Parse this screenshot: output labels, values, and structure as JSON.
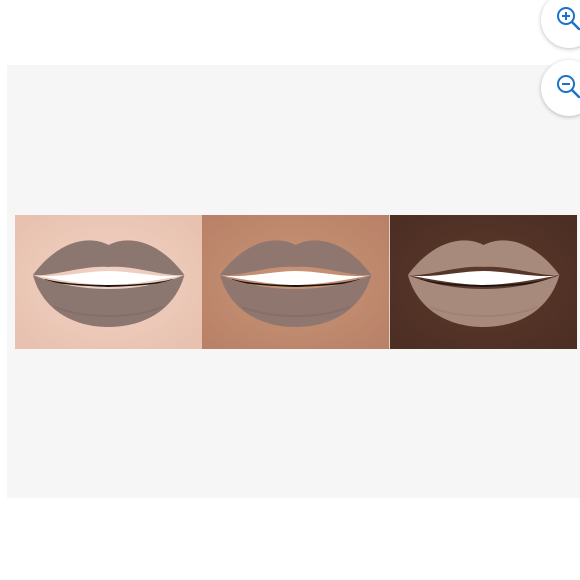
{
  "viewer": {
    "panels": [
      {
        "skin": "#f1d2c4",
        "skin_edge": "#e7c0ae",
        "lip": "#8c7670",
        "lip_dark": "#76615b"
      },
      {
        "skin": "#c99478",
        "skin_edge": "#b88167",
        "lip": "#8f7770",
        "lip_dark": "#77625b"
      },
      {
        "skin": "#5d3a2c",
        "skin_edge": "#4b2d22",
        "lip": "#a88a7c",
        "lip_dark": "#8e7366"
      }
    ]
  },
  "controls": {
    "zoom_in_icon": "zoom-in-icon",
    "zoom_out_icon": "zoom-out-icon",
    "accent": "#1a73c8"
  }
}
